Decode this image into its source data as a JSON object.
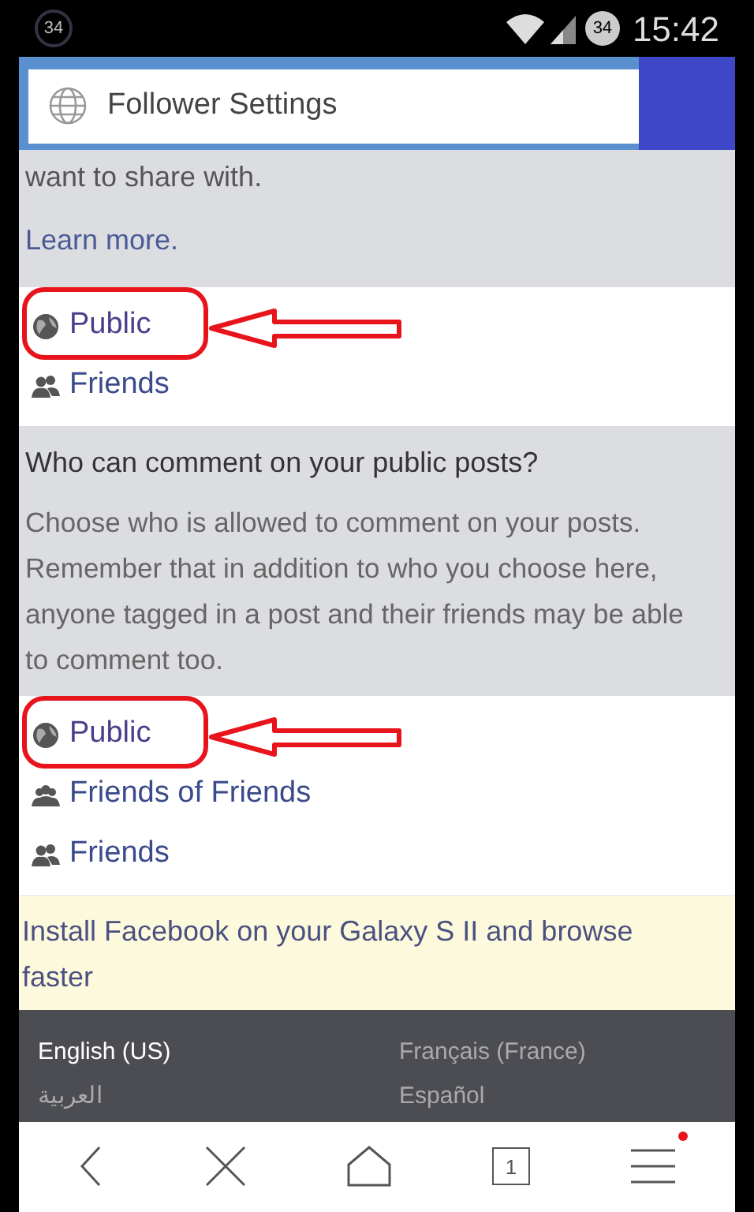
{
  "status_bar": {
    "notification_badge": "34",
    "battery_level_text": "34",
    "time": "15:42"
  },
  "address_bar": {
    "title": "Follower Settings"
  },
  "intro": {
    "text": "want to share with.",
    "link": "Learn more."
  },
  "sections": [
    {
      "options": [
        {
          "label": "Public",
          "kind": "globe",
          "highlighted": true
        },
        {
          "label": "Friends",
          "kind": "friends",
          "highlighted": false
        }
      ]
    },
    {
      "heading": "Who can comment on your public posts?",
      "description": "Choose who is allowed to comment on your posts. Remember that in addition to who you choose here, anyone tagged in a post and their friends may be able to comment too.",
      "options": [
        {
          "label": "Public",
          "kind": "globe",
          "highlighted": true
        },
        {
          "label": "Friends of Friends",
          "kind": "group",
          "highlighted": false
        },
        {
          "label": "Friends",
          "kind": "friends",
          "highlighted": false
        }
      ]
    }
  ],
  "install_banner": "Install Facebook on your Galaxy S II and browse faster",
  "languages": [
    "English (US)",
    "Français (France)",
    "العربية",
    "Español"
  ],
  "bottom_nav": {
    "tab_count": "1",
    "menu_has_notification": true
  }
}
